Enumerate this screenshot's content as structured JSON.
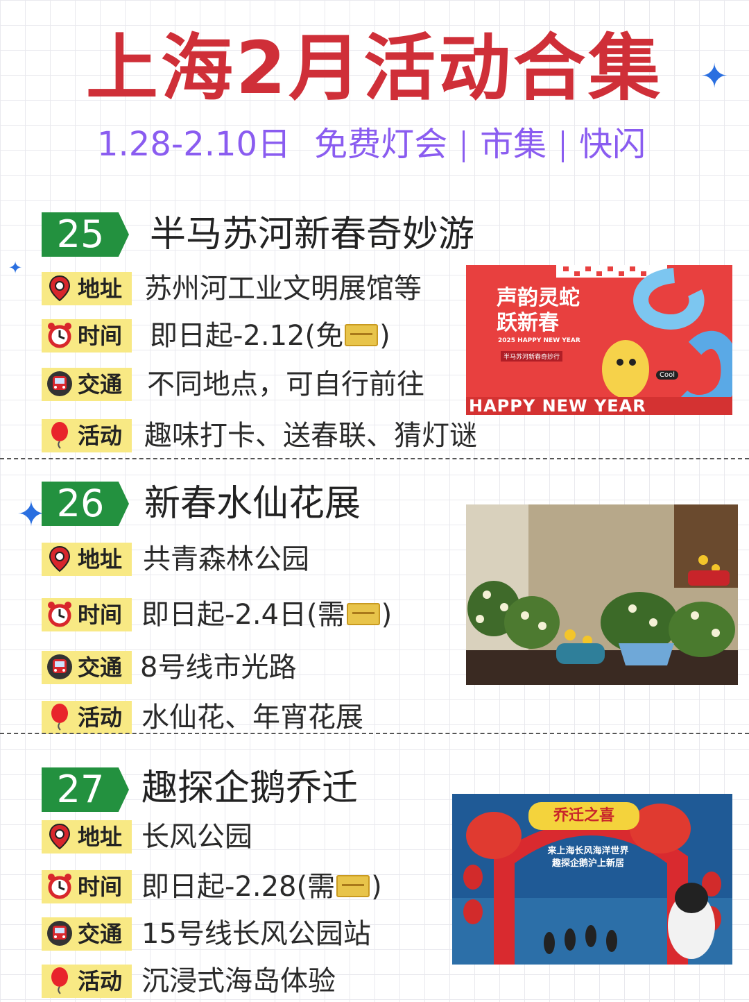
{
  "header": {
    "title": "上海2月活动合集",
    "subtitle_date": "1.28-2.10日",
    "subtitle_tags": [
      "免费灯会",
      "市集",
      "快闪"
    ]
  },
  "labels": {
    "address": "地址",
    "time": "时间",
    "transport": "交通",
    "activity": "活动"
  },
  "icons": {
    "address": "map-pin-icon",
    "time": "alarm-clock-icon",
    "transport": "metro-train-icon",
    "activity": "balloon-icon",
    "ticket": "ticket-icon"
  },
  "colors": {
    "title": "#cf2f38",
    "subtitle": "#8a5cf0",
    "tag_green": "#23913f",
    "label_yellow": "#f8e984",
    "star_blue": "#2a6fe0"
  },
  "events": [
    {
      "number": "25",
      "title": "半马苏河新春奇妙游",
      "address": "苏州河工业文明展馆等",
      "time_text": "即日起-2.12(免",
      "time_suffix": ")",
      "transport": "不同地点，可自行前往",
      "activity": "趣味打卡、送春联、猜灯谜",
      "poster": {
        "headline_1": "声韵灵蛇",
        "headline_2": "跃新春",
        "sub_1": "2025 HAPPY NEW YEAR",
        "sub_2": "半马苏河新春奇妙行",
        "banner": "HAPPY NEW YEAR",
        "badge": "Cool"
      }
    },
    {
      "number": "26",
      "title": "新春水仙花展",
      "address": "共青森林公园",
      "time_text": "即日起-2.4日(需",
      "time_suffix": ")",
      "transport": "8号线市光路",
      "activity": "水仙花、年宵花展"
    },
    {
      "number": "27",
      "title": "趣探企鹅乔迁",
      "address": "长风公园",
      "time_text": "即日起-2.28(需",
      "time_suffix": ")",
      "transport": "15号线长风公园站",
      "activity": "沉浸式海岛体验",
      "poster": {
        "arch_title": "乔迁之喜",
        "line_1": "来上海长风海洋世界",
        "line_2": "趣探企鹅沪上新居"
      }
    }
  ]
}
